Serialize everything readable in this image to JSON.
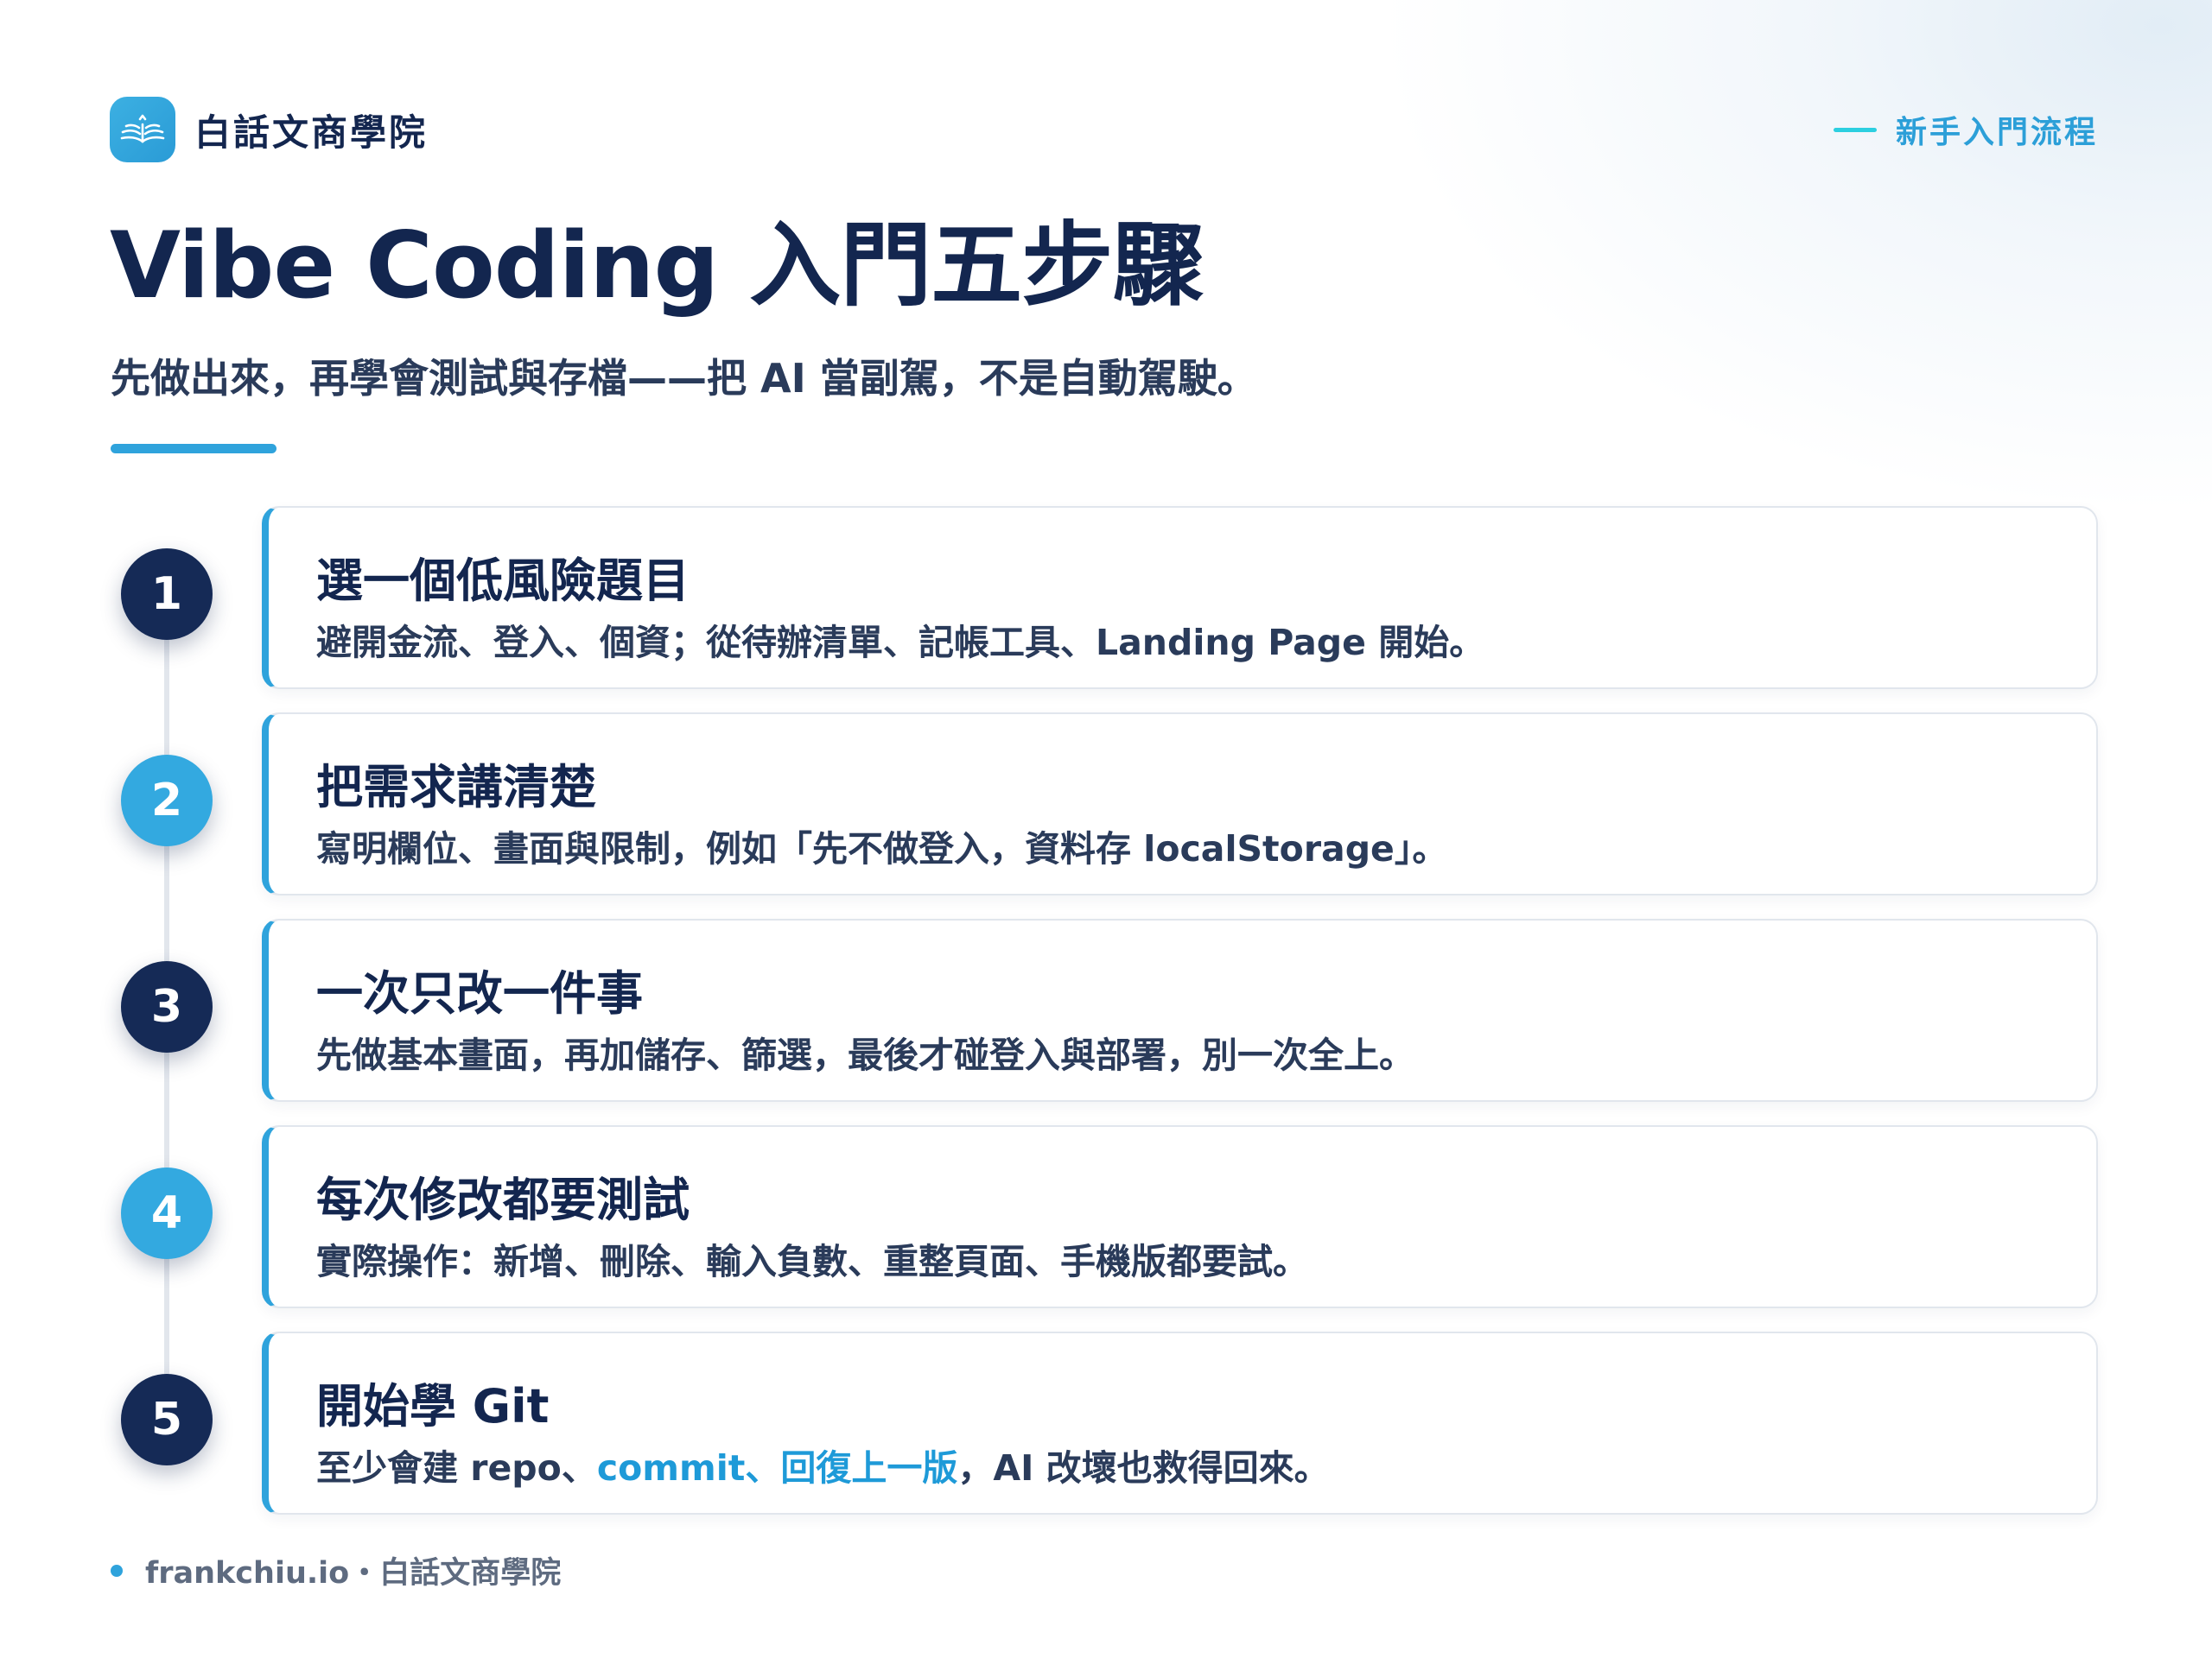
{
  "header": {
    "brand_name": "白話文商學院",
    "tag_label": "新手入門流程"
  },
  "title": "Vibe Coding 入門五步驟",
  "subtitle": "先做出來，再學會測試與存檔——把 AI 當副駕，不是自動駕駛。",
  "steps": [
    {
      "number": "1",
      "title": "選一個低風險題目",
      "desc": "避開金流、登入、個資；從待辦清單、記帳工具、Landing Page 開始。"
    },
    {
      "number": "2",
      "title": "把需求講清楚",
      "desc": "寫明欄位、畫面與限制，例如「先不做登入，資料存 localStorage」。"
    },
    {
      "number": "3",
      "title": "一次只改一件事",
      "desc": "先做基本畫面，再加儲存、篩選，最後才碰登入與部署，別一次全上。"
    },
    {
      "number": "4",
      "title": "每次修改都要測試",
      "desc": "實際操作：新增、刪除、輸入負數、重整頁面、手機版都要試。"
    },
    {
      "number": "5",
      "title": "開始學 Git",
      "desc_before": "至少會建 repo、",
      "desc_highlight": "commit、回復上一版",
      "desc_after": "，AI 改壞也救得回來。"
    }
  ],
  "footer": {
    "text": "frankchiu.io・白話文商學院"
  },
  "colors": {
    "navy": "#13264f",
    "accent_blue": "#2fa3dc",
    "step_dark": "#152a56",
    "step_light": "#33a9e0",
    "tag_line": "#2ccfe0"
  },
  "icons": {
    "logo": "open-book-icon"
  }
}
